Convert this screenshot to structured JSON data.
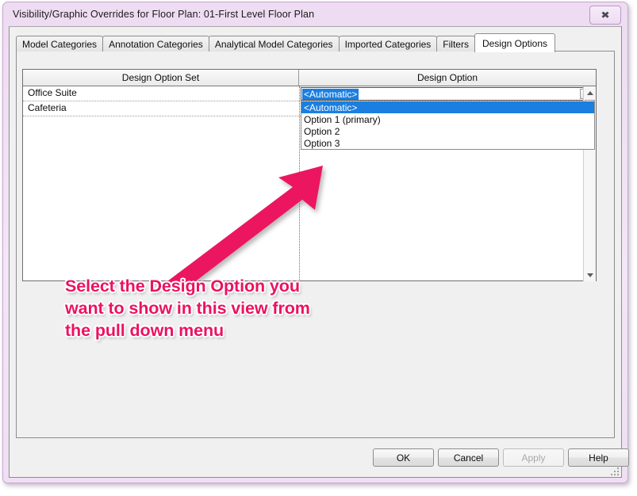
{
  "window": {
    "title": "Visibility/Graphic Overrides for Floor Plan: 01-First Level Floor Plan",
    "close_glyph": "✖",
    "frame_color": "#eedcf2"
  },
  "tabs": [
    {
      "label": "Model Categories",
      "active": false
    },
    {
      "label": "Annotation Categories",
      "active": false
    },
    {
      "label": "Analytical Model Categories",
      "active": false
    },
    {
      "label": "Imported Categories",
      "active": false
    },
    {
      "label": "Filters",
      "active": false
    },
    {
      "label": "Design Options",
      "active": true
    }
  ],
  "grid": {
    "headers": {
      "design_option_set": "Design Option Set",
      "design_option": "Design Option"
    },
    "rows": [
      {
        "set": "Office Suite",
        "option": "<Automatic>"
      },
      {
        "set": "Cafeteria",
        "option": "<Automatic>"
      }
    ]
  },
  "combo": {
    "selected_value": "<Automatic>",
    "expanded": true,
    "highlight_color": "#1a7fe0",
    "options": [
      {
        "label": "<Automatic>",
        "selected": true
      },
      {
        "label": "Option 1 (primary)",
        "selected": false
      },
      {
        "label": "Option 2",
        "selected": false
      },
      {
        "label": "Option 3",
        "selected": false
      }
    ]
  },
  "annotation": {
    "text": "Select the Design Option you want to show in this view from the pull down menu",
    "color": "#ec1260",
    "arrow_color": "#ec1260"
  },
  "buttons": {
    "ok": "OK",
    "cancel": "Cancel",
    "apply": "Apply",
    "help": "Help"
  }
}
